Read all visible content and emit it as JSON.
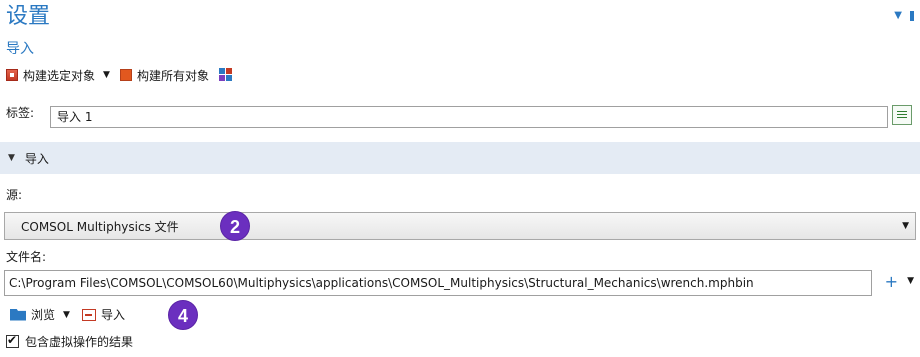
{
  "panel": {
    "title": "设置",
    "subtitle": "导入"
  },
  "toolbar": {
    "build_selected": "构建选定对象",
    "build_all": "构建所有对象"
  },
  "label_field": {
    "label": "标签:",
    "value": "导入 1"
  },
  "section": {
    "title": "导入"
  },
  "source": {
    "label": "源:",
    "selected": "COMSOL Multiphysics 文件"
  },
  "filename": {
    "label": "文件名:",
    "value": "C:\\Program Files\\COMSOL\\COMSOL60\\Multiphysics\\applications\\COMSOL_Multiphysics\\Structural_Mechanics\\wrench.mphbin"
  },
  "actions": {
    "browse": "浏览",
    "import": "导入"
  },
  "checkbox": {
    "label": "包含虚拟操作的结果",
    "checked": true
  },
  "badges": {
    "badge_a": "2",
    "badge_b": "4"
  },
  "colors": {
    "accent": "#2b79c2",
    "badge": "#6b2fbf",
    "section_bg": "#e4ebf4"
  }
}
